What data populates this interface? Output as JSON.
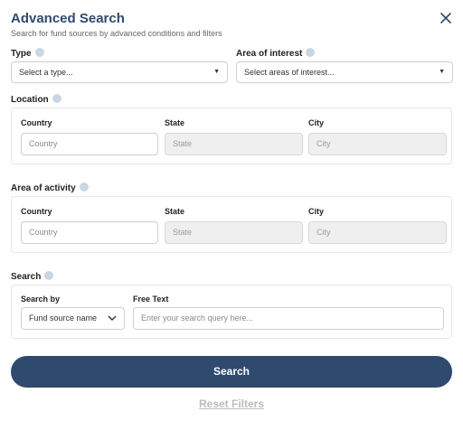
{
  "header": {
    "title": "Advanced Search",
    "subtitle": "Search for fund sources by advanced conditions and filters",
    "close_icon": "close-icon"
  },
  "type": {
    "label": "Type",
    "placeholder": "Select a type..."
  },
  "area_of_interest": {
    "label": "Area of interest",
    "placeholder": "Select areas of interest..."
  },
  "location": {
    "label": "Location",
    "country_label": "Country",
    "country_placeholder": "Country",
    "state_label": "State",
    "state_placeholder": "State",
    "city_label": "City",
    "city_placeholder": "City"
  },
  "area_of_activity": {
    "label": "Area of activity",
    "country_label": "Country",
    "country_placeholder": "Country",
    "state_label": "State",
    "state_placeholder": "State",
    "city_label": "City",
    "city_placeholder": "City"
  },
  "search": {
    "label": "Search",
    "search_by_label": "Search by",
    "search_by_value": "Fund source name",
    "free_text_label": "Free Text",
    "free_text_placeholder": "Enter your search query here..."
  },
  "actions": {
    "search_button": "Search",
    "reset_link": "Reset Filters"
  },
  "colors": {
    "primary": "#2f4a6d",
    "info_dot": "#c9d6e6",
    "reset_text": "#b9bcc2"
  }
}
